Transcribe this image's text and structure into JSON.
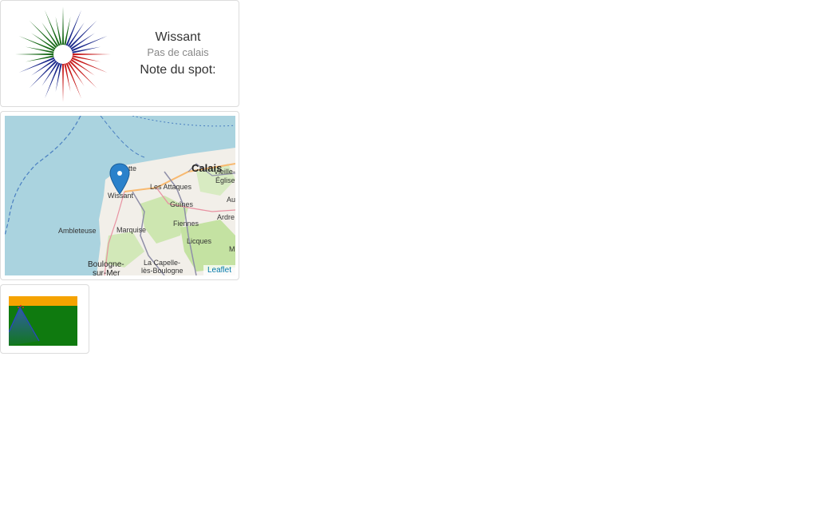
{
  "spot": {
    "name": "Wissant",
    "region": "Pas de calais",
    "rating_label": "Note du spot:"
  },
  "map": {
    "attribution": "Leaflet",
    "labels": {
      "calais": "Calais",
      "wissant": "Wissant",
      "les_attaques": "Les Attaques",
      "guines": "Guînes",
      "ambleteuse": "Ambleteuse",
      "marquise": "Marquise",
      "fiennes": "Fiennes",
      "licques": "Licques",
      "la_capelle": "La Capelle-",
      "les_boulogne": "lès-Boulogne",
      "boulogne": "Boulogne-",
      "sur_mer": "sur-Mer",
      "vieille": "Vieille-",
      "eglise": "Église",
      "ardres": "Ardre",
      "au": "Au",
      "sangatte": "atte",
      "m": "M"
    },
    "marker_icon": "map-pin-icon"
  },
  "colors": {
    "rose_green": "#1a6b1a",
    "rose_blue": "#1c2a8c",
    "rose_red": "#c81e1e",
    "graph_orange": "#f5a300",
    "graph_green": "#0f7a0f",
    "marker": "#2a81cb"
  }
}
